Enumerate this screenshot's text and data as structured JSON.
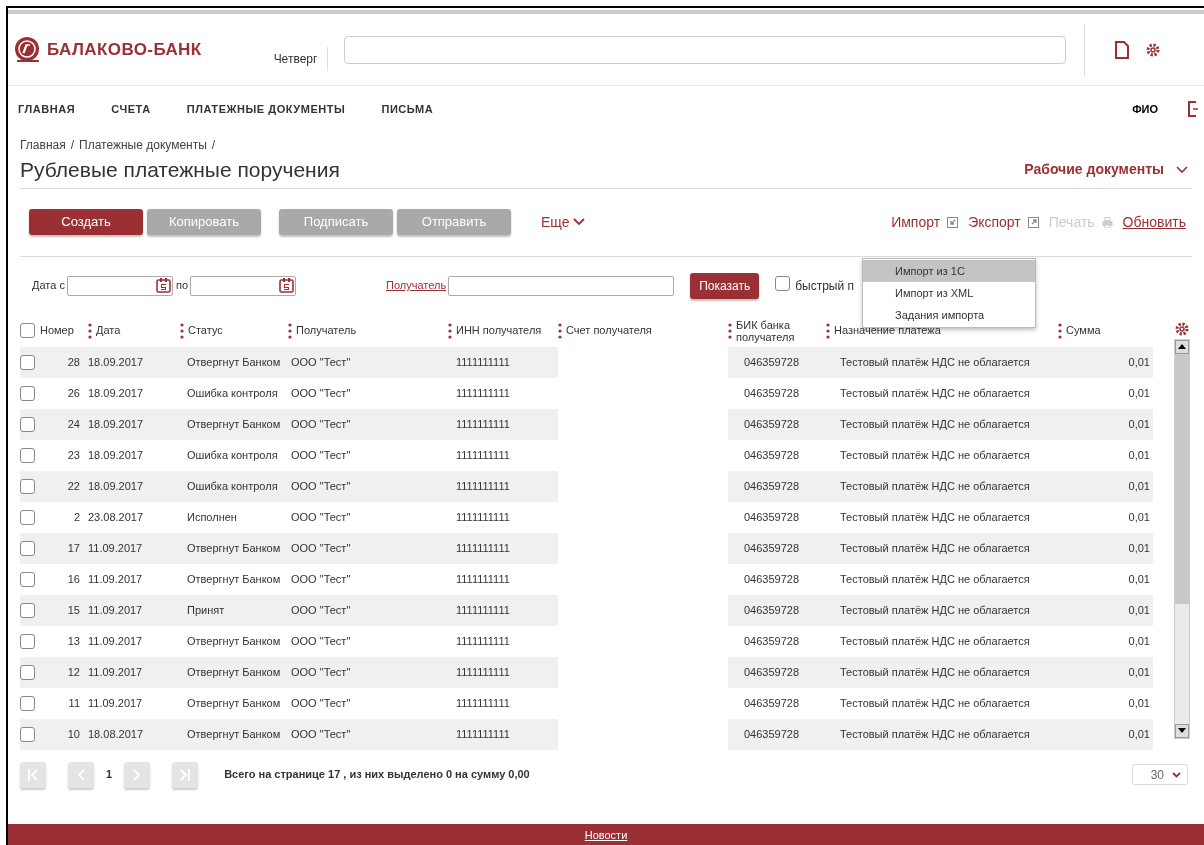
{
  "header": {
    "bank_name": "БАЛАКОВО-БАНК",
    "weekday": "Четверг"
  },
  "nav": {
    "items": [
      {
        "label": "ГЛАВНАЯ"
      },
      {
        "label": "СЧЕТА"
      },
      {
        "label": "ПЛАТЕЖНЫЕ ДОКУМЕНТЫ"
      },
      {
        "label": "ПИСЬМА"
      }
    ],
    "user": "ФИО"
  },
  "breadcrumb": [
    {
      "label": "Главная",
      "separator": "/"
    },
    {
      "label": "Платежные документы",
      "separator": "/"
    }
  ],
  "title": "Рублевые платежные поручения",
  "work_docs": "Рабочие документы",
  "toolbar": {
    "buttons": [
      {
        "label": "Создать",
        "disabled": false
      },
      {
        "label": "Копировать",
        "disabled": true
      },
      {
        "label": "Подписать",
        "disabled": true
      },
      {
        "label": "Отправить",
        "disabled": true
      }
    ],
    "more": "Еще",
    "links": [
      {
        "label": "Импорт",
        "disabled": false,
        "kind": "import"
      },
      {
        "label": "Экспорт",
        "disabled": false,
        "kind": "export"
      },
      {
        "label": "Печать",
        "disabled": true,
        "kind": "print"
      },
      {
        "label": "Обновить",
        "disabled": false,
        "kind": "refresh"
      }
    ]
  },
  "import_menu": [
    {
      "label": "Импорт из 1С",
      "selected": true
    },
    {
      "label": "Импорт из XML",
      "selected": false
    },
    {
      "label": "Задания импорта",
      "selected": false
    }
  ],
  "filter": {
    "date_from_label": "Дата с",
    "date_to_label": "по",
    "recipient_link": "Получатель",
    "show_button": "Показать",
    "quick_label": "быстрый п",
    "quick_checked": false
  },
  "table": {
    "select_all_checked": false,
    "columns": [
      "Номер",
      "Дата",
      "Статус",
      "Получатель",
      "ИНН получателя",
      "Счет получателя",
      "БИК банка получателя",
      "Назначение платежа",
      "Сумма"
    ],
    "rows": [
      {
        "number": "28",
        "date": "18.09.2017",
        "status": "Отвергнут Банком",
        "recipient": "ООО \"Тест\"",
        "inn": "1111111111",
        "bik": "046359728",
        "purpose": "Тестовый платёж НДС не облагается",
        "sum": "0,01",
        "checked": false
      },
      {
        "number": "26",
        "date": "18.09.2017",
        "status": "Ошибка контроля",
        "recipient": "ООО \"Тест\"",
        "inn": "1111111111",
        "bik": "046359728",
        "purpose": "Тестовый платёж НДС не облагается",
        "sum": "0,01",
        "checked": false
      },
      {
        "number": "24",
        "date": "18.09.2017",
        "status": "Отвергнут Банком",
        "recipient": "ООО \"Тест\"",
        "inn": "1111111111",
        "bik": "046359728",
        "purpose": "Тестовый платёж НДС не облагается",
        "sum": "0,01",
        "checked": false
      },
      {
        "number": "23",
        "date": "18.09.2017",
        "status": "Ошибка контроля",
        "recipient": "ООО \"Тест\"",
        "inn": "1111111111",
        "bik": "046359728",
        "purpose": "Тестовый платёж НДС не облагается",
        "sum": "0,01",
        "checked": false
      },
      {
        "number": "22",
        "date": "18.09.2017",
        "status": "Ошибка контроля",
        "recipient": "ООО \"Тест\"",
        "inn": "1111111111",
        "bik": "046359728",
        "purpose": "Тестовый платёж НДС не облагается",
        "sum": "0,01",
        "checked": false
      },
      {
        "number": "2",
        "date": "23.08.2017",
        "status": "Исполнен",
        "recipient": "ООО \"Тест\"",
        "inn": "1111111111",
        "bik": "046359728",
        "purpose": "Тестовый платёж НДС не облагается",
        "sum": "0,01",
        "checked": false
      },
      {
        "number": "17",
        "date": "11.09.2017",
        "status": "Отвергнут Банком",
        "recipient": "ООО \"Тест\"",
        "inn": "1111111111",
        "bik": "046359728",
        "purpose": "Тестовый платёж НДС не облагается",
        "sum": "0,01",
        "checked": false
      },
      {
        "number": "16",
        "date": "11.09.2017",
        "status": "Отвергнут Банком",
        "recipient": "ООО \"Тест\"",
        "inn": "1111111111",
        "bik": "046359728",
        "purpose": "Тестовый платёж НДС не облагается",
        "sum": "0,01",
        "checked": false
      },
      {
        "number": "15",
        "date": "11.09.2017",
        "status": "Принят",
        "recipient": "ООО \"Тест\"",
        "inn": "1111111111",
        "bik": "046359728",
        "purpose": "Тестовый платёж НДС не облагается",
        "sum": "0,01",
        "checked": false
      },
      {
        "number": "13",
        "date": "11.09.2017",
        "status": "Отвергнут Банком",
        "recipient": "ООО \"Тест\"",
        "inn": "1111111111",
        "bik": "046359728",
        "purpose": "Тестовый платёж НДС не облагается",
        "sum": "0,01",
        "checked": false
      },
      {
        "number": "12",
        "date": "11.09.2017",
        "status": "Отвергнут Банком",
        "recipient": "ООО \"Тест\"",
        "inn": "1111111111",
        "bik": "046359728",
        "purpose": "Тестовый платёж НДС не облагается",
        "sum": "0,01",
        "checked": false
      },
      {
        "number": "11",
        "date": "11.09.2017",
        "status": "Отвергнут Банком",
        "recipient": "ООО \"Тест\"",
        "inn": "1111111111",
        "bik": "046359728",
        "purpose": "Тестовый платёж НДС не облагается",
        "sum": "0,01",
        "checked": false
      },
      {
        "number": "10",
        "date": "18.08.2017",
        "status": "Отвергнут Банком",
        "recipient": "ООО \"Тест\"",
        "inn": "1111111111",
        "bik": "046359728",
        "purpose": "Тестовый платёж НДС не облагается",
        "sum": "0,01",
        "checked": false
      }
    ]
  },
  "pagination": {
    "page": "1",
    "summary": "Всего на странице 17 , из них выделено 0 на сумму 0,00",
    "page_size": "30"
  },
  "footer": {
    "link": "Новости"
  }
}
